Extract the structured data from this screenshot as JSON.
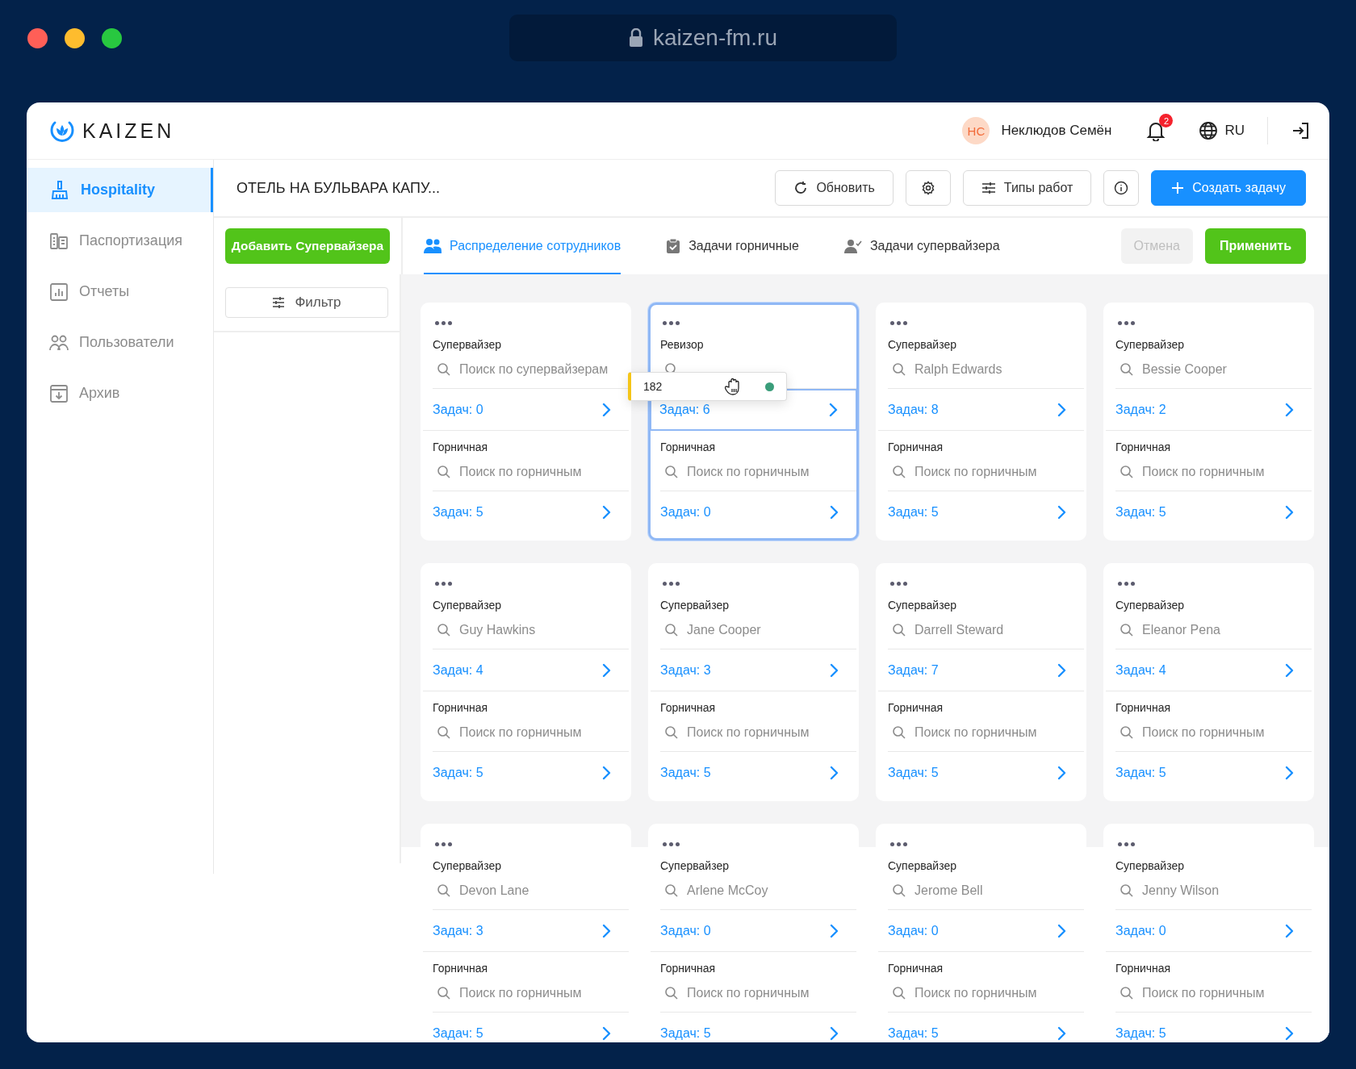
{
  "browser": {
    "address": "kaizen-fm.ru"
  },
  "header": {
    "logo": "KAIZEN",
    "user": {
      "initials": "НС",
      "name": "Неклюдов Семён"
    },
    "notifications": "2",
    "language": "RU"
  },
  "sidebar": {
    "items": [
      {
        "label": "Hospitality",
        "selected": true
      },
      {
        "label": "Паспортизация",
        "selected": false
      },
      {
        "label": "Отчеты",
        "selected": false
      },
      {
        "label": "Пользователи",
        "selected": false
      },
      {
        "label": "Архив",
        "selected": false
      }
    ]
  },
  "page_title": "ОТЕЛЬ НА БУЛЬВАРА КАПУ...",
  "toolbar": [
    {
      "kind": "refresh",
      "label": "Обновить"
    },
    {
      "kind": "settings"
    },
    {
      "kind": "work-types",
      "label": "Типы работ"
    },
    {
      "kind": "info"
    },
    {
      "kind": "create",
      "label": "Создать задачу"
    }
  ],
  "add_button": "Добавить Супервайзера",
  "tabs": [
    {
      "label": "Распределение сотрудников",
      "selected": true
    },
    {
      "label": "Задачи горничные",
      "selected": false
    },
    {
      "label": "Задачи супервайзера",
      "selected": false
    }
  ],
  "actions": [
    {
      "label": "Отмена",
      "disabled": true
    },
    {
      "label": "Применить",
      "disabled": false
    }
  ],
  "filter": "Фильтр",
  "cards": [
    {
      "selected": false,
      "sections": [
        {
          "role": "Супервайзер",
          "search": {
            "placeholder": "Поиск по супервайзерам"
          },
          "tasks": "Задач: 0",
          "highlighted": false
        },
        {
          "role": "Горничная",
          "search": {
            "placeholder": "Поиск по горничным"
          },
          "tasks": "Задач: 5",
          "highlighted": false
        }
      ]
    },
    {
      "selected": true,
      "sections": [
        {
          "role": "Ревизор",
          "tasks": "Задач: 6",
          "highlighted": true
        },
        {
          "role": "Горничная",
          "search": {
            "placeholder": "Поиск по горничным"
          },
          "tasks": "Задач: 0",
          "highlighted": false
        }
      ]
    },
    {
      "selected": false,
      "sections": [
        {
          "role": "Супервайзер",
          "search": {
            "value": "Ralph Edwards"
          },
          "tasks": "Задач: 8",
          "highlighted": false
        },
        {
          "role": "Горничная",
          "search": {
            "placeholder": "Поиск по горничным"
          },
          "tasks": "Задач: 5",
          "highlighted": false
        }
      ]
    },
    {
      "selected": false,
      "sections": [
        {
          "role": "Супервайзер",
          "search": {
            "value": "Bessie Cooper"
          },
          "tasks": "Задач: 2",
          "highlighted": false
        },
        {
          "role": "Горничная",
          "search": {
            "placeholder": "Поиск по горничным"
          },
          "tasks": "Задач: 5",
          "highlighted": false
        }
      ]
    },
    {
      "selected": false,
      "sections": [
        {
          "role": "Супервайзер",
          "search": {
            "value": "Guy Hawkins"
          },
          "tasks": "Задач: 4",
          "highlighted": false
        },
        {
          "role": "Горничная",
          "search": {
            "placeholder": "Поиск по горничным"
          },
          "tasks": "Задач: 5",
          "highlighted": false
        }
      ]
    },
    {
      "selected": false,
      "sections": [
        {
          "role": "Супервайзер",
          "search": {
            "value": "Jane Cooper"
          },
          "tasks": "Задач: 3",
          "highlighted": false
        },
        {
          "role": "Горничная",
          "search": {
            "placeholder": "Поиск по горничным"
          },
          "tasks": "Задач: 5",
          "highlighted": false
        }
      ]
    },
    {
      "selected": false,
      "sections": [
        {
          "role": "Супервайзер",
          "search": {
            "value": "Darrell Steward"
          },
          "tasks": "Задач: 7",
          "highlighted": false
        },
        {
          "role": "Горничная",
          "search": {
            "placeholder": "Поиск по горничным"
          },
          "tasks": "Задач: 5",
          "highlighted": false
        }
      ]
    },
    {
      "selected": false,
      "sections": [
        {
          "role": "Супервайзер",
          "search": {
            "value": "Eleanor Pena"
          },
          "tasks": "Задач: 4",
          "highlighted": false
        },
        {
          "role": "Горничная",
          "search": {
            "placeholder": "Поиск по горничным"
          },
          "tasks": "Задач: 5",
          "highlighted": false
        }
      ]
    },
    {
      "selected": false,
      "sections": [
        {
          "role": "Супервайзер",
          "search": {
            "value": "Devon Lane"
          },
          "tasks": "Задач: 3",
          "highlighted": false
        },
        {
          "role": "Горничная",
          "search": {
            "placeholder": "Поиск по горничным"
          },
          "tasks": "Задач: 5",
          "highlighted": false
        }
      ]
    },
    {
      "selected": false,
      "sections": [
        {
          "role": "Супервайзер",
          "search": {
            "value": "Arlene McCoy"
          },
          "tasks": "Задач: 0",
          "highlighted": false
        },
        {
          "role": "Горничная",
          "search": {
            "placeholder": "Поиск по горничным"
          },
          "tasks": "Задач: 5",
          "highlighted": false
        }
      ]
    },
    {
      "selected": false,
      "sections": [
        {
          "role": "Супервайзер",
          "search": {
            "value": "Jerome Bell"
          },
          "tasks": "Задач: 0",
          "highlighted": false
        },
        {
          "role": "Горничная",
          "search": {
            "placeholder": "Поиск по горничным"
          },
          "tasks": "Задач: 5",
          "highlighted": false
        }
      ]
    },
    {
      "selected": false,
      "sections": [
        {
          "role": "Супервайзер",
          "search": {
            "value": "Jenny Wilson"
          },
          "tasks": "Задач: 0",
          "highlighted": false
        },
        {
          "role": "Горничная",
          "search": {
            "placeholder": "Поиск по горничным"
          },
          "tasks": "Задач: 5",
          "highlighted": false
        }
      ]
    }
  ],
  "drag_chip": {
    "label": "182"
  }
}
